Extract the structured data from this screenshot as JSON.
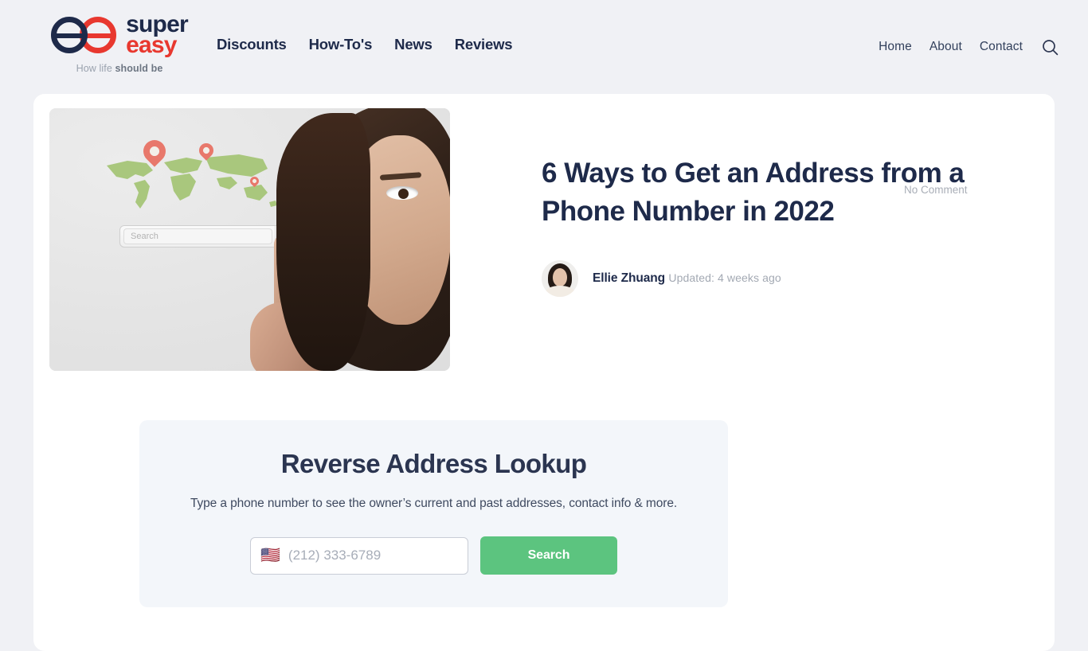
{
  "header": {
    "logo": {
      "word_part1": "super",
      "word_part2": "easy",
      "tagline_light": "How life ",
      "tagline_bold": "should be",
      "navy": "#1e2a4a",
      "red": "#e8382f"
    },
    "nav_main": [
      {
        "label": "Discounts"
      },
      {
        "label": "How-To's"
      },
      {
        "label": "News"
      },
      {
        "label": "Reviews"
      }
    ],
    "nav_right": [
      {
        "label": "Home"
      },
      {
        "label": "About"
      },
      {
        "label": "Contact"
      }
    ],
    "search_icon": "search-icon"
  },
  "article": {
    "title": "6 Ways to Get an Address from a Phone Number in 2022",
    "author": "Ellie Zhuang",
    "updated": "Updated: 4 weeks ago",
    "comments": "No Comment",
    "hero_image": {
      "alt": "Woman pointing at a search bar over a world map with location pins",
      "inner_search_placeholder": "Search",
      "map_color": "#a9c77d",
      "pin_color": "#e8786b"
    }
  },
  "lookup": {
    "heading": "Reverse Address Lookup",
    "subtitle": "Type a phone number to see the owner’s current and past addresses, contact info & more.",
    "flag": "🇺🇸",
    "phone_placeholder": "(212) 333-6789",
    "phone_value": "",
    "submit_label": "Search",
    "submit_color": "#5cc47f",
    "panel_color": "#f3f6fa"
  }
}
